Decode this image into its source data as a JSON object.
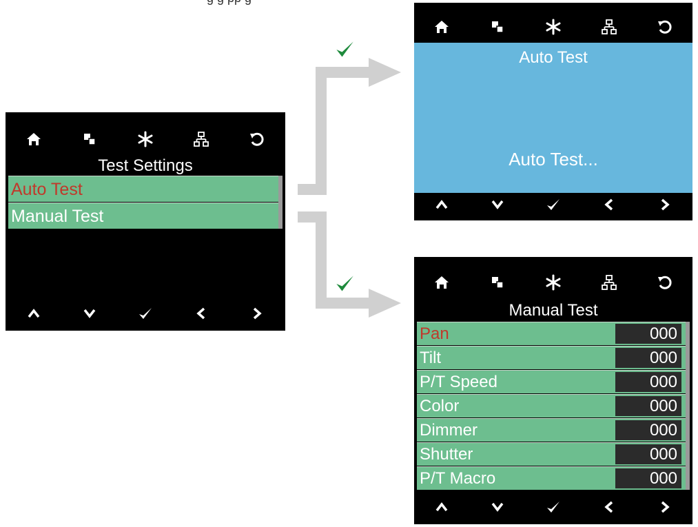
{
  "fragment": "g     g  pp        g",
  "icons": {
    "top": [
      "home-icon",
      "copy-icon",
      "asterisk-icon",
      "network-icon",
      "undo-icon"
    ],
    "bottom": [
      "up-icon",
      "down-icon",
      "check-icon",
      "left-icon",
      "right-icon"
    ]
  },
  "test_settings": {
    "title": "Test Settings",
    "items": [
      {
        "label": "Auto Test",
        "selected": true
      },
      {
        "label": "Manual Test",
        "selected": false
      }
    ]
  },
  "auto_test": {
    "title": "Auto Test",
    "status": "Auto Test..."
  },
  "manual_test": {
    "title": "Manual Test",
    "rows": [
      {
        "label": "Pan",
        "value": "000",
        "selected": true
      },
      {
        "label": "Tilt",
        "value": "000"
      },
      {
        "label": "P/T Speed",
        "value": "000"
      },
      {
        "label": "Color",
        "value": "000"
      },
      {
        "label": "Dimmer",
        "value": "000"
      },
      {
        "label": "Shutter",
        "value": "000"
      },
      {
        "label": "P/T Macro",
        "value": "000"
      }
    ]
  },
  "colors": {
    "screen_bg": "#000000",
    "row_green": "#6dbe8f",
    "selected_text": "#c0392b",
    "auto_bg": "#67b7dd",
    "value_bg": "#2b2b2b",
    "arrow": "#d0d0d0",
    "check": "#1e8a3c"
  }
}
